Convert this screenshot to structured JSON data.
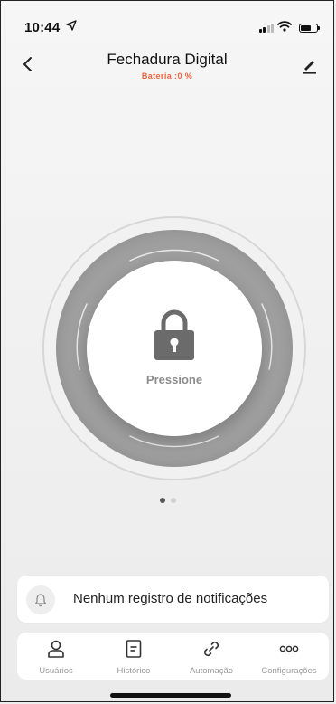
{
  "status_bar": {
    "time": "10:44"
  },
  "header": {
    "title": "Fechadura Digital",
    "subtitle": "Bateria :0 %"
  },
  "lock": {
    "label": "Pressione"
  },
  "pager": {
    "pages": 2,
    "active": 0,
    "active_color": "#555555",
    "inactive_color": "#d0d0d0"
  },
  "notification": {
    "text": "Nenhum registro de notificações"
  },
  "tabs": [
    {
      "label": "Usuários",
      "icon": "user-icon"
    },
    {
      "label": "Histórico",
      "icon": "history-icon"
    },
    {
      "label": "Automação",
      "icon": "link-icon"
    },
    {
      "label": "Configurações",
      "icon": "more-icon"
    }
  ],
  "colors": {
    "battery_warning": "#f0623f",
    "ring": "#9f9f9f",
    "lock_icon": "#6b6b6b"
  }
}
